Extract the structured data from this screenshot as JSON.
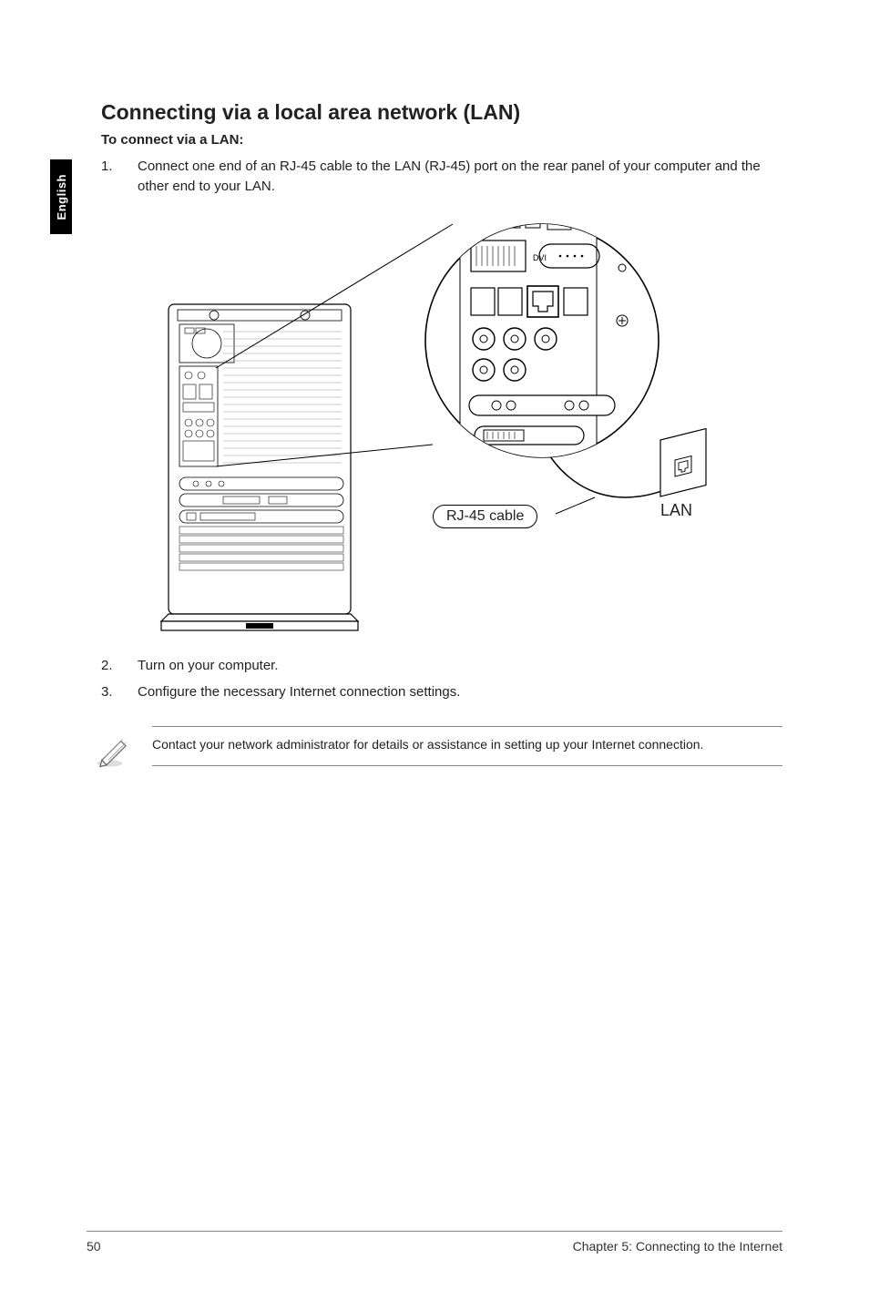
{
  "sideTab": "English",
  "heading": "Connecting via a local area network (LAN)",
  "subheading": "To connect via a LAN:",
  "steps": [
    {
      "num": "1.",
      "text": "Connect one end of an RJ-45 cable to the LAN (RJ-45) port on the rear panel of your computer and the other end to your LAN."
    },
    {
      "num": "2.",
      "text": "Turn on your computer."
    },
    {
      "num": "3.",
      "text": "Configure the necessary Internet connection settings."
    }
  ],
  "figure": {
    "cableLabel": "RJ-45 cable",
    "lanLabel": "LAN",
    "zoomPortLabel": "DVI"
  },
  "note": "Contact your network administrator for details or assistance in setting up your Internet connection.",
  "footer": {
    "pageNumber": "50",
    "chapter": "Chapter 5: Connecting to the Internet"
  }
}
